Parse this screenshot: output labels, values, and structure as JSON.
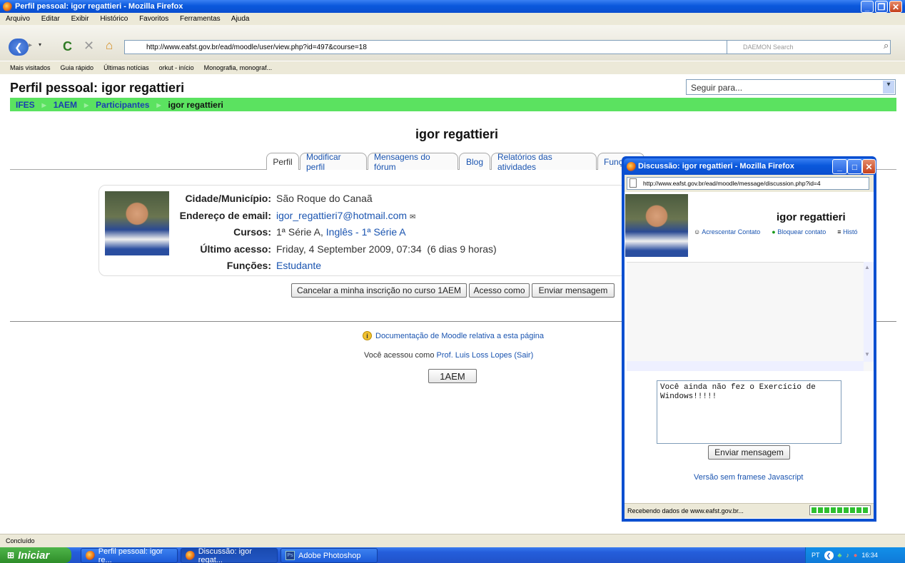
{
  "window": {
    "title": "Perfil pessoal: igor regattieri - Mozilla Firefox",
    "menu": [
      "Arquivo",
      "Editar",
      "Exibir",
      "Histórico",
      "Favoritos",
      "Ferramentas",
      "Ajuda"
    ],
    "url": "http://www.eafst.gov.br/ead/moodle/user/view.php?id=497&course=18",
    "search_placeholder": "DAEMON Search",
    "bookmarks": [
      "Mais visitados",
      "Guia rápido",
      "Últimas notícias",
      "orkut - início",
      "Monografia, monograf..."
    ],
    "status": "Concluído"
  },
  "page": {
    "heading": "Perfil pessoal: igor regattieri",
    "jump_placeholder": "Seguir para...",
    "breadcrumb": [
      "IFES",
      "1AEM",
      "Participantes",
      "igor regattieri"
    ],
    "user_name": "igor regattieri",
    "tabs": [
      "Perfil",
      "Modificar perfil",
      "Mensagens do fórum",
      "Blog",
      "Relatórios das atividades",
      "Funç"
    ],
    "fields": [
      {
        "label": "Cidade/Município:",
        "value": "São Roque do Canaã"
      },
      {
        "label": "Endereço de email:",
        "value": "igor_regattieri7@hotmail.com"
      },
      {
        "label": "Cursos:",
        "value_plain": "1ª Série A,",
        "value_link": "Inglês - 1ª Série A"
      },
      {
        "label": "Último acesso:",
        "value": "Friday, 4 September 2009, 07:34  (6 dias 9 horas)"
      },
      {
        "label": "Funções:",
        "value": "Estudante"
      }
    ],
    "buttons": {
      "unenrol": "Cancelar a minha inscrição no curso 1AEM",
      "login_as": "Acesso como",
      "send_message": "Enviar mensagem"
    },
    "doc_link": "Documentação de Moodle relativa a esta página",
    "logged_prefix": "Você acessou como",
    "logged_user": "Prof. Luis Loss Lopes",
    "logout": "(Sair)",
    "course_button": "1AEM"
  },
  "popup": {
    "title": "Discussão: igor regattieri - Mozilla Firefox",
    "url": "http://www.eafst.gov.br/ead/moodle/message/discussion.php?id=4",
    "user_name": "igor regattieri",
    "add_contact": "Acrescentar Contato",
    "block_contact": "Bloquear contato",
    "history": "Histó",
    "message_text": "Você ainda não fez o Exercício de Windows!!!!!",
    "send_button": "Enviar mensagem",
    "noframes_link": "Versão sem framese Javascript",
    "status": "Recebendo dados de www.eafst.gov.br..."
  },
  "taskbar": {
    "start": "Iniciar",
    "items": [
      "Perfil pessoal: igor re...",
      "Discussão: igor regat...",
      "Adobe Photoshop"
    ],
    "lang": "PT",
    "clock": "16:34"
  },
  "colors": {
    "breadcrumb_bg": "#5be260",
    "link": "#1a54b0",
    "xp_blue": "#0a58dc"
  }
}
